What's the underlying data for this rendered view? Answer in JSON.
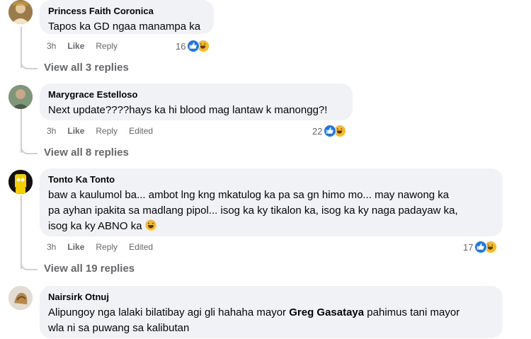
{
  "comments": [
    {
      "author": "Princess Faith Coronica",
      "text": "Tapos ka GD ngaa manampa ka",
      "time": "3h",
      "like": "Like",
      "reply": "Reply",
      "reactions": "16",
      "replies": "View all 3 replies"
    },
    {
      "author": "Marygrace Estelloso",
      "text": "Next update????hays ka hi blood mag lantaw k manongg?!",
      "time": "3h",
      "like": "Like",
      "reply": "Reply",
      "edited": "Edited",
      "reactions": "22",
      "replies": "View all 8 replies"
    },
    {
      "author": "Tonto Ka Tonto",
      "text_line1": "baw a kaulumol ba... ambot lng kng mkatulog ka pa sa gn himo mo... may nawong ka",
      "text_line2": "pa ayhan ipakita sa madlang pipol... isog ka ky tikalon ka, isog ka ky naga padayaw ka,",
      "text_line3": "isog ka ky ABNO ka",
      "time": "3h",
      "like": "Like",
      "reply": "Reply",
      "edited": "Edited",
      "reactions": "17",
      "replies": "View all 19 replies"
    },
    {
      "author": "Nairsirk Otnuj",
      "text_pre": "Alipungoy nga lalaki bilatibay agi gli hahaha mayor ",
      "text_bold": "Greg Gasataya",
      "text_post": " pahimus tani mayor",
      "text_line2": "wla ni sa puwang sa kalibutan"
    }
  ],
  "colors": {
    "bubble": "#f0f2f5",
    "meta": "#65676b",
    "like_blue": "#1877f2",
    "haha_yellow": "#f7b928"
  }
}
